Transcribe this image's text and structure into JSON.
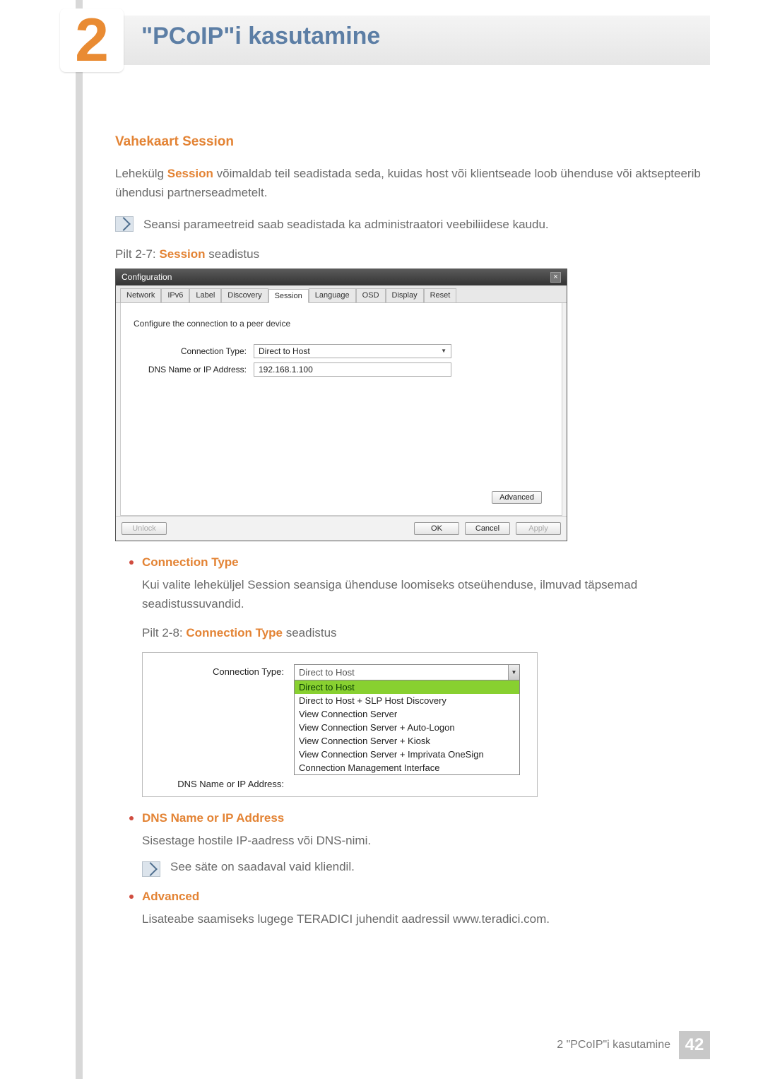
{
  "chapter": {
    "number": "2",
    "title": "\"PCoIP\"i kasutamine"
  },
  "section_heading": "Vahekaart Session",
  "intro": {
    "prefix": "Lehekülg ",
    "highlight": "Session",
    "suffix": " võimaldab teil seadistada seda, kuidas host või klientseade loob ühenduse või aktsepteerib ühendusi partnerseadmetelt."
  },
  "note1": "Seansi parameetreid saab seadistada ka administraatori veebiliidese kaudu.",
  "fig27_caption": {
    "prefix": "Pilt 2-7: ",
    "highlight": "Session",
    "suffix": " seadistus"
  },
  "config": {
    "title": "Configuration",
    "tabs": [
      "Network",
      "IPv6",
      "Label",
      "Discovery",
      "Session",
      "Language",
      "OSD",
      "Display",
      "Reset"
    ],
    "active_tab_index": 4,
    "instruction": "Configure the connection to a peer device",
    "connection_type_label": "Connection Type:",
    "connection_type_value": "Direct to Host",
    "dns_label": "DNS Name or IP Address:",
    "dns_value": "192.168.1.100",
    "advanced_btn": "Advanced",
    "unlock_btn": "Unlock",
    "ok_btn": "OK",
    "cancel_btn": "Cancel",
    "apply_btn": "Apply"
  },
  "bullets": {
    "ct_title": "Connection Type",
    "ct_text": "Kui valite leheküljel Session seansiga ühenduse loomiseks otseühenduse, ilmuvad täpsemad seadistussuvandid.",
    "ct_caption": {
      "prefix": "Pilt 2-8: ",
      "highlight": "Connection Type",
      "suffix": " seadistus"
    },
    "dns_title": "DNS Name or IP Address",
    "dns_text": "Sisestage hostile IP-aadress või DNS-nimi.",
    "dns_note": "See säte on saadaval vaid kliendil.",
    "adv_title": "Advanced",
    "adv_text": "Lisateabe saamiseks lugege TERADICI juhendit aadressil www.teradici.com."
  },
  "ct_fig": {
    "connection_type_label": "Connection Type:",
    "dns_label": "DNS Name or IP Address:",
    "selected": "Direct to Host",
    "options": [
      "Direct to Host",
      "Direct to Host + SLP Host Discovery",
      "View Connection Server",
      "View Connection Server + Auto-Logon",
      "View Connection Server + Kiosk",
      "View Connection Server + Imprivata OneSign",
      "Connection Management Interface"
    ],
    "highlight_index": 0
  },
  "footer": {
    "text": "2 \"PCoIP\"i kasutamine",
    "page": "42"
  }
}
